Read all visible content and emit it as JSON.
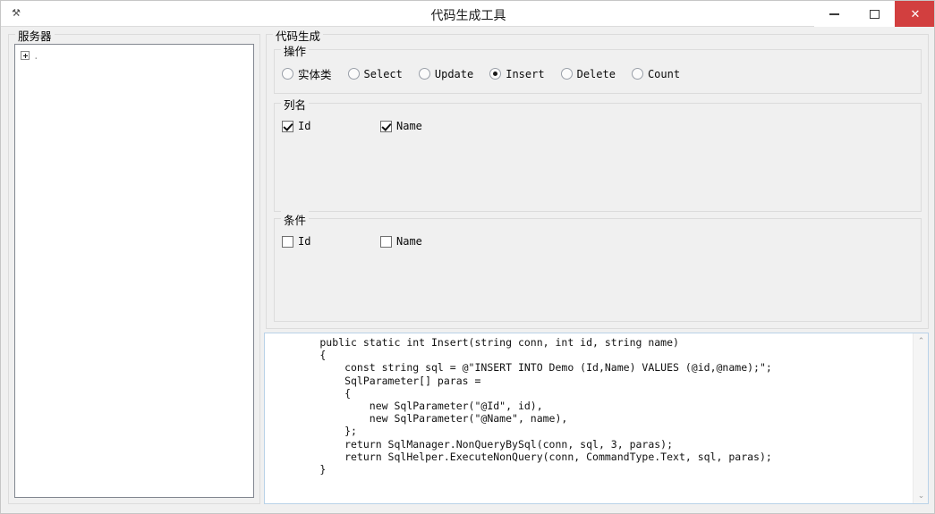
{
  "window": {
    "title": "代码生成工具",
    "app_icon": "app-icon",
    "controls": {
      "minimize": "–",
      "maximize": "▢",
      "close": "✕"
    }
  },
  "server_panel": {
    "group_label": "服务器",
    "tree": [
      {
        "expander": "+",
        "label": "."
      }
    ]
  },
  "codegen": {
    "group_label": "代码生成",
    "operation": {
      "group_label": "操作",
      "options": [
        {
          "label": "实体类",
          "checked": false,
          "cjk": true
        },
        {
          "label": "Select",
          "checked": false,
          "cjk": false
        },
        {
          "label": "Update",
          "checked": false,
          "cjk": false
        },
        {
          "label": "Insert",
          "checked": true,
          "cjk": false
        },
        {
          "label": "Delete",
          "checked": false,
          "cjk": false
        },
        {
          "label": "Count",
          "checked": false,
          "cjk": false
        }
      ]
    },
    "columns": {
      "group_label": "列名",
      "items": [
        {
          "label": "Id",
          "checked": true
        },
        {
          "label": "Name",
          "checked": true
        }
      ]
    },
    "conditions": {
      "group_label": "条件",
      "items": [
        {
          "label": "Id",
          "checked": false
        },
        {
          "label": "Name",
          "checked": false
        }
      ]
    }
  },
  "code_output": {
    "text": "        public static int Insert(string conn, int id, string name)\n        {\n            const string sql = @\"INSERT INTO Demo (Id,Name) VALUES (@id,@name);\";\n            SqlParameter[] paras =\n            {\n                new SqlParameter(\"@Id\", id),\n                new SqlParameter(\"@Name\", name),\n            };\n            return SqlManager.NonQueryBySql(conn, sql, 3, paras);\n            return SqlHelper.ExecuteNonQuery(conn, CommandType.Text, sql, paras);\n        }",
    "scroll_up": "⌃",
    "scroll_down": "⌄"
  },
  "colors": {
    "close_button": "#d23f3f",
    "window_background": "#f0f0f0",
    "groupbox_border": "#dcdcdc",
    "code_border": "#b9d2e8"
  }
}
